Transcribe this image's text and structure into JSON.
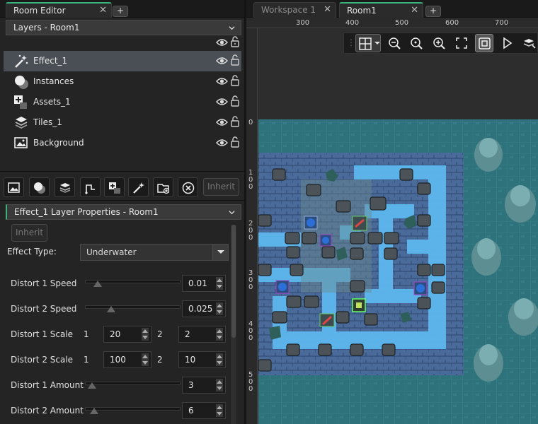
{
  "left_tabs": {
    "room_editor": "Room Editor",
    "add": "+"
  },
  "layers_panel": {
    "title": "Layers - Room1"
  },
  "layers": [
    {
      "name": "Effect_1",
      "icon": "effect-icon",
      "selected": true
    },
    {
      "name": "Instances",
      "icon": "instances-icon",
      "selected": false
    },
    {
      "name": "Assets_1",
      "icon": "assets-icon",
      "selected": false
    },
    {
      "name": "Tiles_1",
      "icon": "tiles-icon",
      "selected": false
    },
    {
      "name": "Background",
      "icon": "background-icon",
      "selected": false
    }
  ],
  "layer_toolbar": {
    "inherit": "Inherit"
  },
  "properties": {
    "title": "Effect_1 Layer Properties - Room1",
    "inherit": "Inherit",
    "effect_type_label": "Effect Type:",
    "effect_type_value": "Underwater",
    "distort1_speed": {
      "label": "Distort 1 Speed",
      "value": "0.01",
      "slider_fraction": 0.1
    },
    "distort2_speed": {
      "label": "Distort 2 Speed",
      "value": "0.025",
      "slider_fraction": 0.25
    },
    "distort1_scale": {
      "label": "Distort 1 Scale",
      "i1": "1",
      "v1": "20",
      "i2": "2",
      "v2": "2"
    },
    "distort2_scale": {
      "label": "Distort 2 Scale",
      "i1": "1",
      "v1": "100",
      "i2": "2",
      "v2": "10"
    },
    "distort1_amount": {
      "label": "Distort 1 Amount",
      "value": "3",
      "slider_fraction": 0.03
    },
    "distort2_amount": {
      "label": "Distort 2 Amount",
      "value": "6",
      "slider_fraction": 0.06
    }
  },
  "right_tabs": {
    "workspace": "Workspace 1",
    "room": "Room1",
    "add": "+"
  },
  "ruler": {
    "top": [
      "300",
      "400",
      "500",
      "600",
      "700"
    ],
    "left": [
      [
        "0"
      ],
      [
        "1",
        "0",
        "0"
      ],
      [
        "2",
        "0",
        "0"
      ],
      [
        "3",
        "0",
        "0"
      ],
      [
        "4",
        "0",
        "0"
      ],
      [
        "5",
        "0",
        "0"
      ]
    ]
  },
  "colors": {
    "accent": "#3ab27a",
    "selected_row": "#4a4f55",
    "water": "#4aa6e8"
  }
}
